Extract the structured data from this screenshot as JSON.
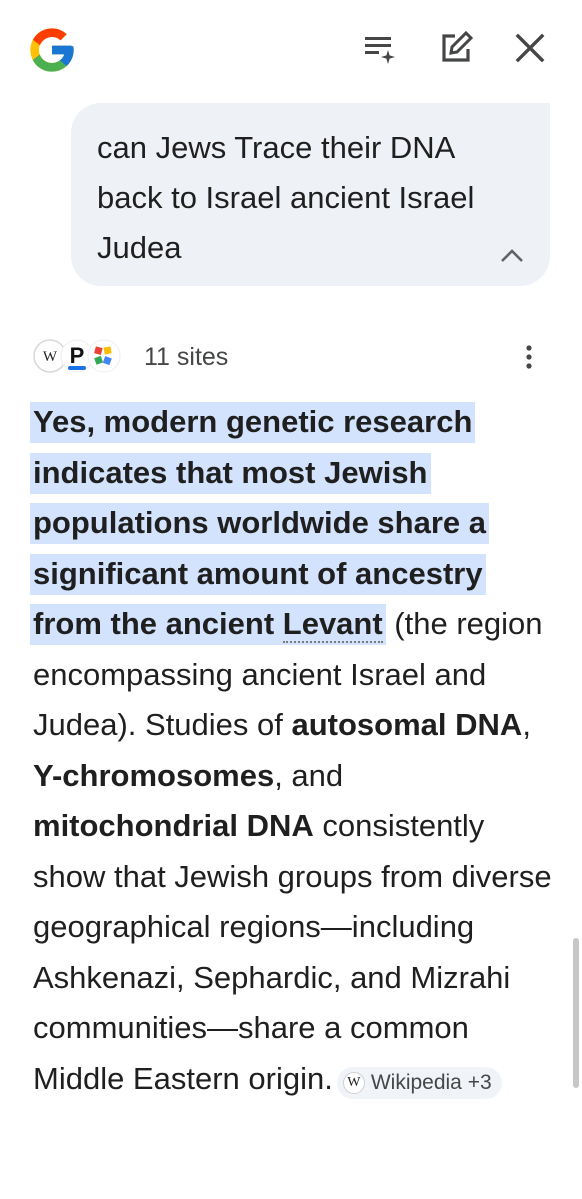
{
  "header": {
    "logo_icon": "google-g-icon",
    "filter_icon": "list-sparkle-icon",
    "edit_icon": "edit-icon",
    "close_icon": "close-icon"
  },
  "query": {
    "text": "can Jews Trace their DNA back to Israel ancient Israel Judea",
    "collapse_icon": "chevron-up-icon"
  },
  "sources": {
    "count_label": "11 sites",
    "icons": [
      "wikipedia-icon",
      "p-site-icon",
      "colorful-site-icon"
    ],
    "more_icon": "more-vert-icon"
  },
  "answer": {
    "highlight_text": "Yes, modern genetic research indicates that most Jewish populations worldwide share a significant amount of ancestry from the ancient ",
    "highlight_link": "Levant",
    "text_1": " (the region encompassing ancient Israel and Judea). Studies of ",
    "bold_1": "autosomal DNA",
    "text_2": ", ",
    "bold_2": "Y-chromosomes",
    "text_3": ", and ",
    "bold_3": "mitochondrial DNA",
    "text_4": " consistently show that Jewish groups from diverse geographical regions—including Ashkenazi, Sephardic, and Mizrahi communities—share a common Middle Eastern origin.",
    "citation_icon_letter": "W",
    "citation_label": "Wikipedia +3"
  },
  "colors": {
    "highlight": "#d3e3fd",
    "query_bubble": "#eef1f6",
    "chip_bg": "#f0f4f9"
  }
}
